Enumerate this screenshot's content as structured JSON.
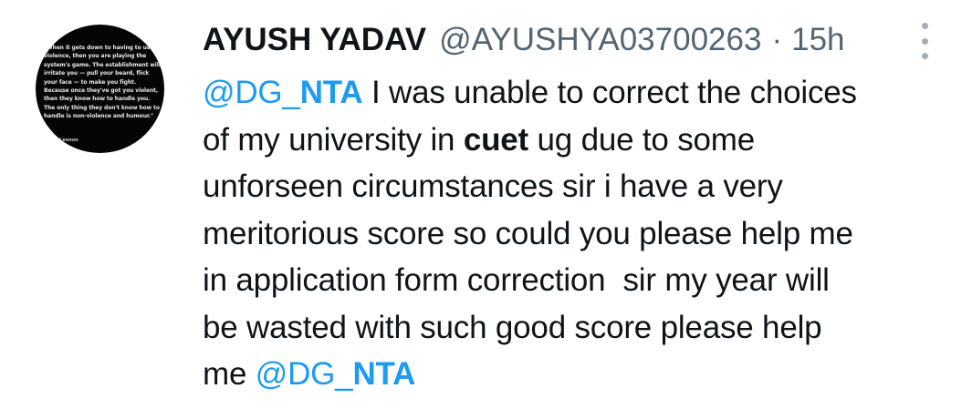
{
  "avatar": {
    "quote": "\"When it gets down to having to use violence, then you are playing the system's game. The establishment will irritate you — pull your beard, flick your face — to make you fight. Because once they've got you violent, then they know how to handle you. The only thing they don't know how to handle is non-violence and humour.\"",
    "author": "John Lennon"
  },
  "tweet": {
    "display_name": "AYUSH YADAV",
    "handle": "@AYUSHYA03700263",
    "separator": "·",
    "time": "15h",
    "more_icon": "vertical-ellipsis-icon",
    "mention_prefix": "@DG_",
    "mention_bold": "NTA",
    "line1_rest": " I was unable to correct the choices",
    "line2_pre": "of my university in ",
    "line2_bold": "cuet",
    "line2_post": " ug due to some",
    "line3": "unforseen circumstances sir i have a very",
    "line4": "meritorious score so could you please help me",
    "line5": "in application form correction  sir my year will",
    "line6": "be wasted with such good score please help",
    "line7": "me "
  },
  "colors": {
    "text": "#0f1419",
    "secondary": "#536471",
    "link": "#1d9bf0",
    "avatar_bg": "#050505"
  }
}
